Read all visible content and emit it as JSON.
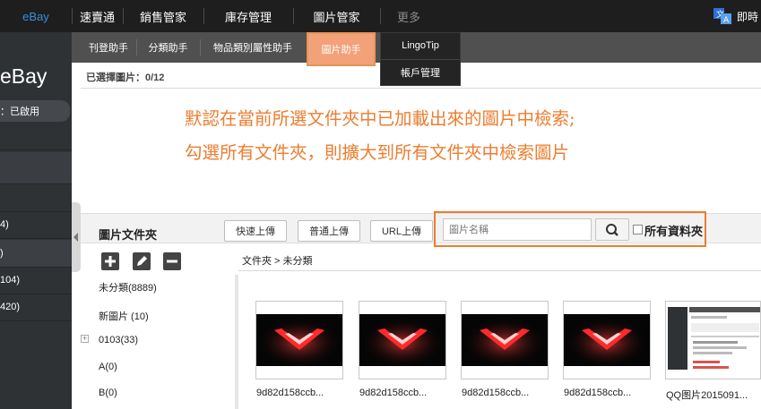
{
  "topbar": {
    "items": [
      {
        "label": "eBay"
      },
      {
        "label": "速賣通"
      },
      {
        "label": "銷售管家"
      },
      {
        "label": "庫存管理"
      },
      {
        "label": "圖片管家"
      },
      {
        "label": "更多"
      }
    ],
    "right_label": "即時"
  },
  "sidebar": {
    "title": "eBay",
    "status": "：已啟用",
    "items": [
      {
        "label": "4)"
      },
      {
        "label": ")"
      },
      {
        "label": "104)"
      },
      {
        "label": "420)"
      }
    ]
  },
  "subtabs": {
    "items": [
      {
        "label": "刊登助手"
      },
      {
        "label": "分類助手"
      },
      {
        "label": "物品類別屬性助手"
      },
      {
        "label": "圖片助手"
      }
    ]
  },
  "dropdown": {
    "items": [
      {
        "label": "LingoTip"
      },
      {
        "label": "帳戶管理"
      }
    ]
  },
  "main": {
    "selected_count": "已選擇圖片：0/12",
    "annotation_line1": "默認在當前所選文件夾中已加載出來的圖片中檢索;",
    "annotation_line2": "勾選所有文件夾，則擴大到所有文件夾中檢索圖片"
  },
  "toolbar": {
    "folder_title": "圖片文件夾",
    "quick_upload": "快速上傳",
    "normal_upload": "普通上傳",
    "url_upload": "URL上傳",
    "search_placeholder": "圖片名稱",
    "all_folders": "所有資料夾"
  },
  "folders": {
    "items": [
      {
        "label": "未分類(8889)"
      },
      {
        "label": "新圖片 (10)"
      },
      {
        "label": "0103(33)"
      },
      {
        "label": "A(0)"
      },
      {
        "label": "B(0)"
      }
    ]
  },
  "breadcrumb": "文件夾 > 未分類",
  "images": {
    "items": [
      {
        "caption": "9d82d158ccb..."
      },
      {
        "caption": "9d82d158ccb..."
      },
      {
        "caption": "9d82d158ccb..."
      },
      {
        "caption": "9d82d158ccb..."
      },
      {
        "caption": "QQ图片2015091..."
      }
    ]
  },
  "colors": {
    "topbar_bg": "#1e1e1e",
    "accent_orange": "#ec7d2f",
    "active_tab": "#f2a179",
    "ebay_blue": "#3a8fe0"
  }
}
